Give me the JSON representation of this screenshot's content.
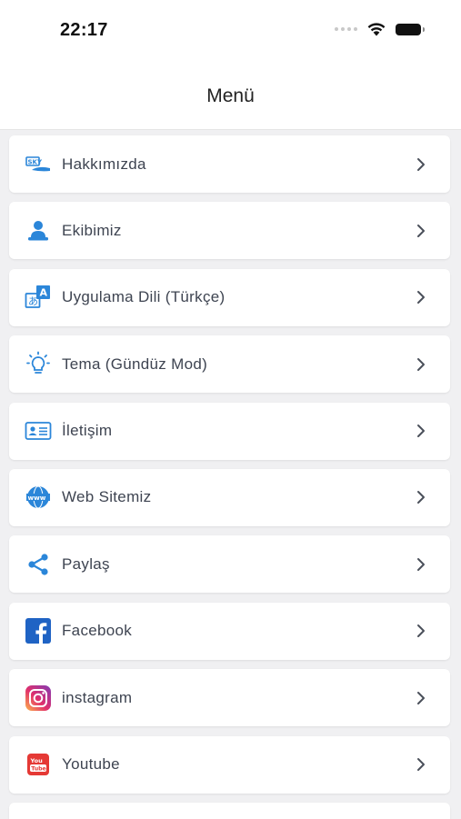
{
  "status_bar": {
    "time": "22:17"
  },
  "nav": {
    "title": "Menü"
  },
  "colors": {
    "accent": "#2b86d9",
    "facebook": "#1877f2",
    "youtube": "#e53935"
  },
  "menu": {
    "items": [
      {
        "label": "Hakkımızda",
        "icon": "about-logo-icon"
      },
      {
        "label": "Ekibimiz",
        "icon": "team-icon"
      },
      {
        "label": "Uygulama Dili (Türkçe)",
        "icon": "translate-icon"
      },
      {
        "label": "Tema (Gündüz Mod)",
        "icon": "lightbulb-icon"
      },
      {
        "label": "İletişim",
        "icon": "contact-card-icon"
      },
      {
        "label": "Web Sitemiz",
        "icon": "www-globe-icon"
      },
      {
        "label": "Paylaş",
        "icon": "share-icon"
      },
      {
        "label": "Facebook",
        "icon": "facebook-icon"
      },
      {
        "label": "instagram",
        "icon": "instagram-icon"
      },
      {
        "label": "Youtube",
        "icon": "youtube-icon"
      }
    ]
  }
}
